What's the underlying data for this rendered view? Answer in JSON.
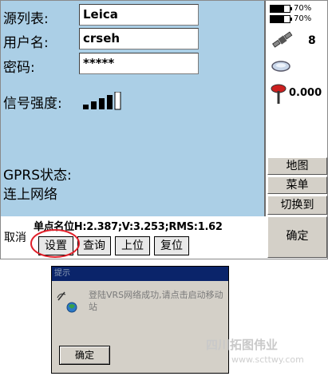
{
  "form": {
    "source_list_label": "源列表:",
    "source_list_value": "Leica",
    "username_label": "用户名:",
    "username_value": "crseh",
    "password_label": "密码:",
    "password_value": "*****",
    "signal_label": "信号强度:",
    "gprs_status_label": "GPRS状态:",
    "gprs_status_value": "连上网络"
  },
  "status": {
    "battery1": "70%",
    "battery2": "70%",
    "battery1_level": 0.7,
    "battery2_level": 0.7,
    "satellites": "8",
    "height_value": "0.000"
  },
  "signal": {
    "level": 4,
    "max": 5
  },
  "side_buttons": {
    "map": "地图",
    "menu": "菜单",
    "switch": "切换到",
    "ok": "确定"
  },
  "bottom": {
    "quality_text": "单点名位H:2.387;V:3.253;RMS:1.62",
    "cancel": "取消",
    "settings": "设置",
    "query": "查询",
    "up": "上位",
    "reset": "复位"
  },
  "dialog": {
    "title": "提示",
    "message": "登陆VRS网络成功,请点击启动移动站",
    "ok": "确定"
  },
  "watermark": {
    "line1": "四川拓图伟业",
    "line2": "www.scttwy.com"
  },
  "colors": {
    "panel": "#abcfe6",
    "dialog_title": "#0a246a",
    "highlight_circle": "#e0202a"
  }
}
